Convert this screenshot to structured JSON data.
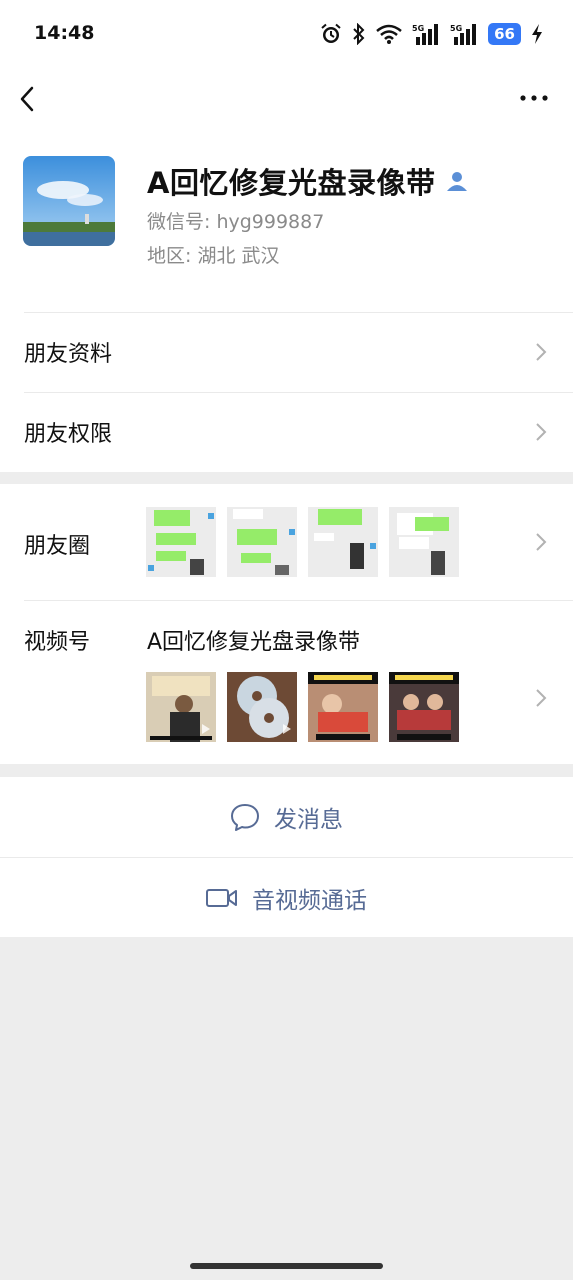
{
  "status_bar": {
    "time": "14:48",
    "battery": "66",
    "network1": "5G",
    "network2": "5G"
  },
  "nav": {
    "back": "back-arrow-icon",
    "more": "more-dots-icon"
  },
  "profile": {
    "name": "A回忆修复光盘录像带",
    "wechat_id": "微信号: hyg999887",
    "region": "地区: 湖北  武汉"
  },
  "menu": {
    "friend_info": "朋友资料",
    "friend_permissions": "朋友权限"
  },
  "moments": {
    "label": "朋友圈"
  },
  "channels": {
    "label": "视频号",
    "name": "A回忆修复光盘录像带"
  },
  "actions": {
    "send_message": "发消息",
    "video_call": "音视频通话"
  },
  "colors": {
    "link": "#576b95",
    "accent": "#3478f6",
    "background": "#ededed"
  }
}
